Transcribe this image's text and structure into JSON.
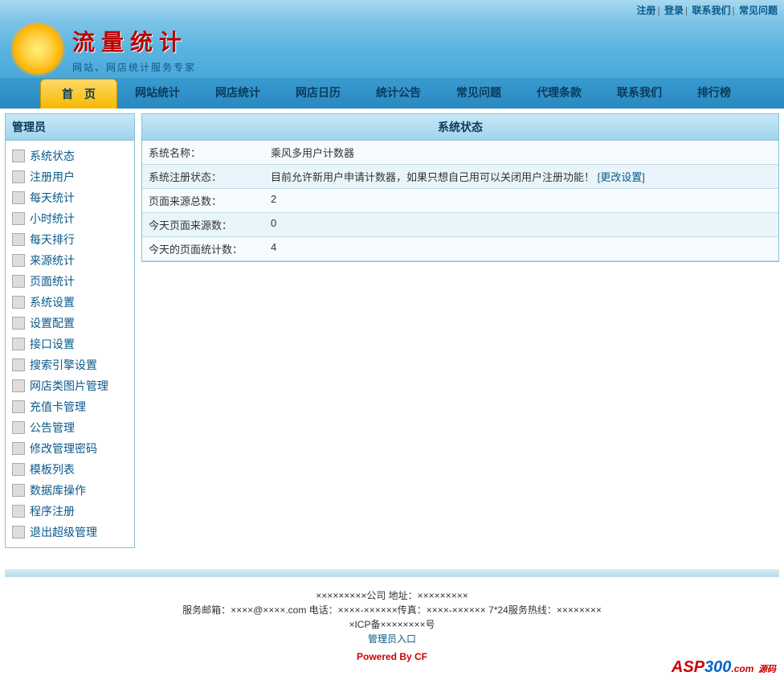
{
  "topLinks": {
    "register": "注册",
    "login": "登录",
    "contact": "联系我们",
    "faq": "常见问题"
  },
  "logo": {
    "title": "流量统计",
    "subtitle": "网站、网店统计服务专家"
  },
  "nav": [
    {
      "label": "首　页",
      "active": true
    },
    {
      "label": "网站统计",
      "active": false
    },
    {
      "label": "网店统计",
      "active": false
    },
    {
      "label": "网店日历",
      "active": false
    },
    {
      "label": "统计公告",
      "active": false
    },
    {
      "label": "常见问题",
      "active": false
    },
    {
      "label": "代理条款",
      "active": false
    },
    {
      "label": "联系我们",
      "active": false
    },
    {
      "label": "排行榜",
      "active": false
    }
  ],
  "sidebar": {
    "title": "管理员",
    "items": [
      {
        "label": "系统状态"
      },
      {
        "label": "注册用户"
      },
      {
        "label": "每天统计"
      },
      {
        "label": "小时统计"
      },
      {
        "label": "每天排行"
      },
      {
        "label": "来源统计"
      },
      {
        "label": "页面统计"
      },
      {
        "label": "系统设置"
      },
      {
        "label": "设置配置"
      },
      {
        "label": "接口设置"
      },
      {
        "label": "搜索引擎设置"
      },
      {
        "label": "网店类图片管理"
      },
      {
        "label": "充值卡管理"
      },
      {
        "label": "公告管理"
      },
      {
        "label": "修改管理密码"
      },
      {
        "label": "模板列表"
      },
      {
        "label": "数据库操作"
      },
      {
        "label": "程序注册"
      },
      {
        "label": "退出超级管理"
      }
    ]
  },
  "content": {
    "title": "系统状态",
    "rows": [
      {
        "label": "系统名称：",
        "value": "乘风多用户计数器"
      },
      {
        "label": "系统注册状态：",
        "value": "目前允许新用户申请计数器，如果只想自己用可以关闭用户注册功能！",
        "link": "[更改设置]"
      },
      {
        "label": "页面来源总数：",
        "value": "2"
      },
      {
        "label": "今天页面来源数：",
        "value": "0"
      },
      {
        "label": "今天的页面统计数：",
        "value": "4"
      }
    ]
  },
  "footer": {
    "line1": "×××××××××公司  地址：×××××××××",
    "line2": "服务邮箱：××××@××××.com 电话：××××-××××××传真：××××-×××××× 7*24服务热线：××××××××",
    "line3": "×ICP备××××××××号",
    "adminLink": "管理员入口",
    "powered": "Powered By CF",
    "aspLogo": {
      "part1": "ASP",
      "part2": "300",
      "part3": ".com",
      "badge": "源码"
    }
  }
}
